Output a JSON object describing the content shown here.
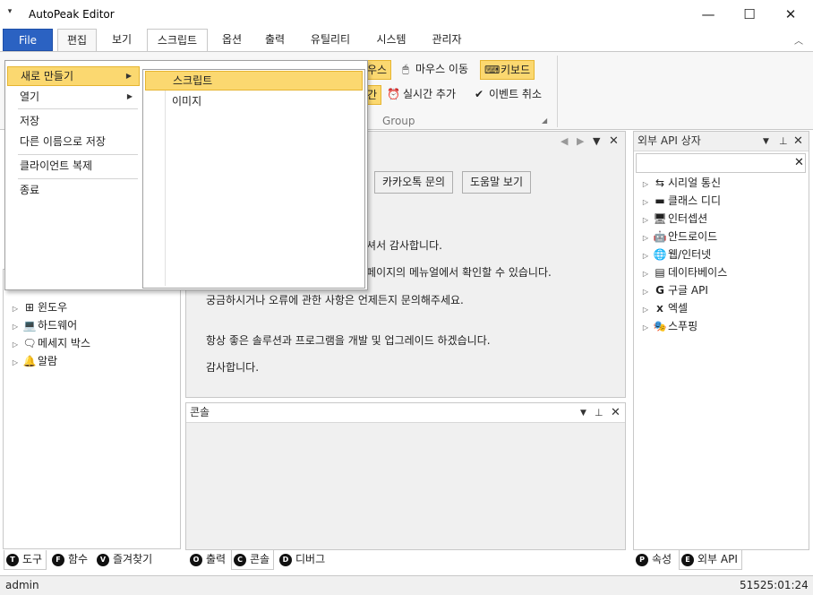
{
  "titlebar": {
    "quick_access_icon": "▾",
    "title": "AutoPeak Editor",
    "minimize": "—",
    "maximize": "☐",
    "close": "✕"
  },
  "menu": {
    "file": "File",
    "tabs": [
      "편집",
      "보기",
      "스크립트",
      "옵션",
      "출력",
      "유틸리티",
      "시스템",
      "관리자"
    ],
    "active_tab": "스크립트",
    "collapse_icon": "︿"
  },
  "ribbon": {
    "partial_button_1": "우스",
    "mouse_move": "마우스 이동",
    "keyboard": "키보드",
    "partial_button_2": "간",
    "realtime_add": "실시간 추가",
    "event_cancel": "이벤트 취소",
    "group_label": "Group",
    "colors": {
      "highlight": "#fbd870",
      "highlight_border": "#e6b530"
    }
  },
  "file_menu": {
    "items": [
      {
        "label": "새로 만들기",
        "has_submenu": true
      },
      {
        "label": "열기",
        "has_submenu": true
      },
      {
        "label": "저장"
      },
      {
        "label": "다른 이름으로 저장"
      },
      {
        "label": "클라이언트 복제"
      },
      {
        "label": "종료"
      }
    ],
    "submenu_arrow": "▶",
    "submenu_items": [
      "스크립트",
      "이미지"
    ]
  },
  "left_panel": {
    "tree": [
      {
        "label": "윈도우",
        "icon": "windows-icon"
      },
      {
        "label": "하드웨어",
        "icon": "laptop-icon"
      },
      {
        "label": "메세지 박스",
        "icon": "message-box-icon"
      },
      {
        "label": "알람",
        "icon": "bell-icon"
      }
    ],
    "tabs": [
      {
        "badge": "T",
        "label": "도구"
      },
      {
        "badge": "F",
        "label": "함수"
      },
      {
        "badge": "V",
        "label": "즐겨찾기"
      }
    ]
  },
  "center_panel": {
    "kakao_button": "카카오톡 문의",
    "help_button": "도움말 보기",
    "messages": [
      "주셔서 감사합니다.",
      "홈페이지의 메뉴얼에서 확인할 수 있습니다.",
      "궁금하시거나 오류에 관한 사항은 언제든지 문의해주세요.",
      "항상 좋은 솔루션과 프로그램을 개발 및 업그레이드 하겠습니다.",
      "감사합니다."
    ]
  },
  "console_panel": {
    "title": "콘솔",
    "tabs": [
      {
        "badge": "O",
        "label": "출력"
      },
      {
        "badge": "C",
        "label": "콘솔"
      },
      {
        "badge": "D",
        "label": "디버그"
      }
    ]
  },
  "right_panel": {
    "title": "외부 API 상자",
    "search_placeholder": "",
    "clear_icon": "✕",
    "tree": [
      {
        "label": "시리얼 통신",
        "icon": "serial-icon"
      },
      {
        "label": "클래스 디디",
        "icon": "class-icon"
      },
      {
        "label": "인터셉션",
        "icon": "monitor-icon"
      },
      {
        "label": "안드로이드",
        "icon": "android-icon"
      },
      {
        "label": "웹/인터넷",
        "icon": "globe-icon"
      },
      {
        "label": "데이타베이스",
        "icon": "database-icon"
      },
      {
        "label": "구글 API",
        "icon": "google-icon"
      },
      {
        "label": "엑셀",
        "icon": "excel-icon"
      },
      {
        "label": "스푸핑",
        "icon": "mask-icon"
      }
    ],
    "tabs": [
      {
        "badge": "P",
        "label": "속성"
      },
      {
        "badge": "E",
        "label": "외부 API"
      }
    ]
  },
  "panel_controls": {
    "dropdown": "▼",
    "pin": "📌",
    "close": "✕",
    "prev": "◀",
    "next": "▶"
  },
  "status": {
    "user": "admin",
    "time": "51525:01:24"
  }
}
